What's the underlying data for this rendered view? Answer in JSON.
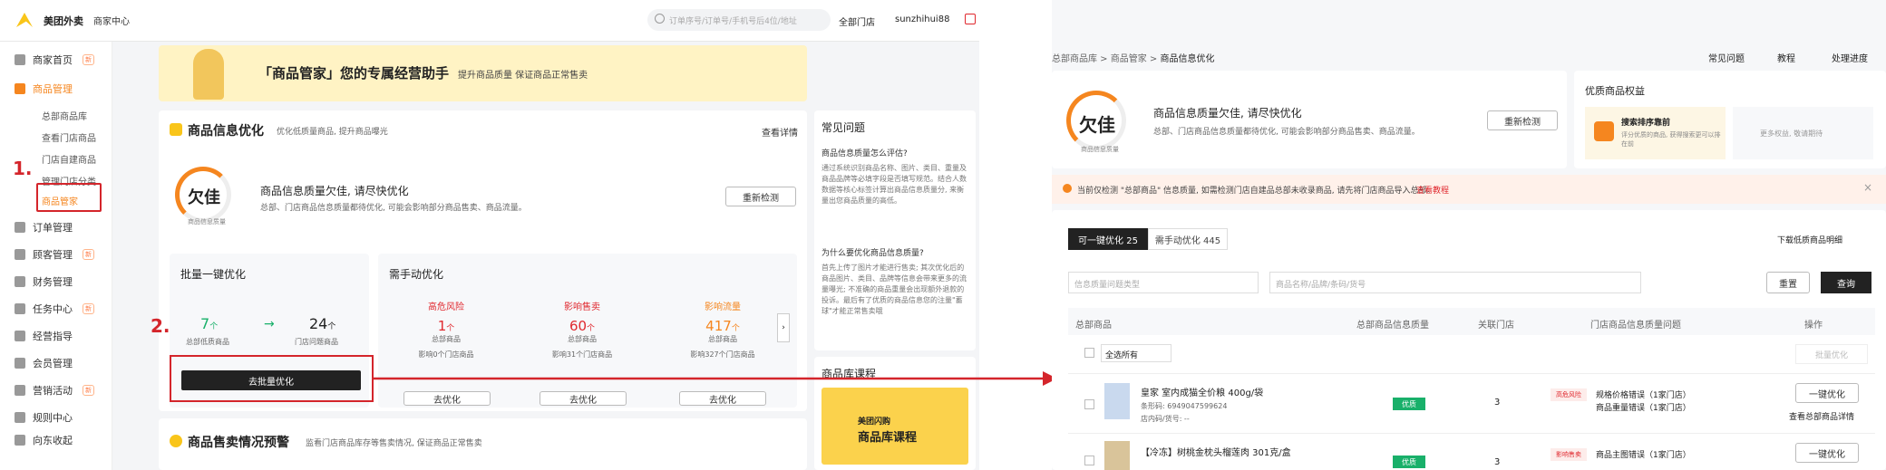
{
  "topbar": {
    "logo": "美团外卖",
    "section": "商家中心",
    "search_placeholder": "订单序号/订单号/手机号后4位/地址",
    "store_select": "全部门店",
    "user": "sunzhihui88"
  },
  "sidebar": {
    "items": [
      {
        "label": "商家首页",
        "badge": "新"
      },
      {
        "label": "商品管理",
        "badge": ""
      },
      {
        "label": "订单管理",
        "badge": ""
      },
      {
        "label": "顾客管理",
        "badge": "新"
      },
      {
        "label": "财务管理",
        "badge": ""
      },
      {
        "label": "任务中心",
        "badge": "新"
      },
      {
        "label": "经营指导",
        "badge": ""
      },
      {
        "label": "会员管理",
        "badge": ""
      },
      {
        "label": "营销活动",
        "badge": "新"
      },
      {
        "label": "规则中心",
        "badge": ""
      },
      {
        "label": "向东收起",
        "badge": ""
      }
    ],
    "sub_items": [
      "总部商品库",
      "查看门店商品",
      "门店自建商品",
      "管理门店分类",
      "商品管家"
    ]
  },
  "steps": {
    "one": "1.",
    "two": "2."
  },
  "banner": {
    "title": "「商品管家」您的专属经营助手",
    "subtitle": "提升商品质量 保证商品正常售卖"
  },
  "optimize": {
    "title": "商品信息优化",
    "subtitle": "优化低质量商品, 提升商品曝光",
    "view_detail": "查看详情",
    "grade": "欠佳",
    "grade_caption": "商品信息质量",
    "status_title": "商品信息质量欠佳, 请尽快优化",
    "status_desc": "总部、门店商品信息质量都待优化, 可能会影响部分商品售卖、商品流量。",
    "refresh": "重新检测"
  },
  "batch": {
    "title": "批量一键优化",
    "left_num": "7",
    "left_unit": "个",
    "left_label": "总部低质商品",
    "right_num": "24",
    "right_unit": "个",
    "right_label": "门店问题商品",
    "button": "去批量优化"
  },
  "manual": {
    "title": "需手动优化",
    "cols": [
      {
        "label": "高危风险",
        "num": "1",
        "unit": "个",
        "sub": "总部商品",
        "note": "影响0个门店商品",
        "btn": "去优化"
      },
      {
        "label": "影响售卖",
        "num": "60",
        "unit": "个",
        "sub": "总部商品",
        "note": "影响31个门店商品",
        "btn": "去优化"
      },
      {
        "label": "影响流量",
        "num": "417",
        "unit": "个",
        "sub": "总部商品",
        "note": "影响327个门店商品",
        "btn": "去优化"
      }
    ]
  },
  "faq": {
    "title": "常见问题",
    "q1": "商品信息质量怎么评估?",
    "a1": "通过系统识别商品名称、图片、类目、重量及商品品牌等必填字段是否填写规范。结合人数数据等核心标签计算出商品信息质量分, 来衡量出您商品质量的高低。",
    "q2": "为什么要优化商品信息质量?",
    "a2": "首先上传了图片才能进行售卖; 其次优化后的商品图片、类目、品牌等信息会带来更多的流量曝光; 不准确的商品重量会出现额外退款的投诉。最后有了优质的商品信息您的注量\"蓄球\"才能正常售卖哦"
  },
  "course": {
    "title": "商品库课程",
    "brand": "美团闪购",
    "name": "商品库课程"
  },
  "sales_warning": {
    "title": "商品售卖情况预警",
    "desc": "监看门店商品库存等售卖情况, 保证商品正常售卖"
  },
  "right": {
    "breadcrumb": [
      "总部商品库",
      "商品管家",
      "商品信息优化"
    ],
    "toplinks": [
      "常见问题",
      "教程",
      "处理进度"
    ],
    "grade": "欠佳",
    "grade_caption": "商品信息质量",
    "status_title": "商品信息质量欠佳, 请尽快优化",
    "status_desc": "总部、门店商品信息质量都待优化, 可能会影响部分商品售卖、商品流量。",
    "refresh": "重新检测",
    "rights_title": "优质商品权益",
    "rights_1_title": "搜索排序靠前",
    "rights_1_desc": "评分优质的商品, 获得搜索更可以排在前",
    "rights_2": "更多权益, 敬请期待",
    "alert": "当前仅检测 \"总部商品\" 信息质量, 如需检测门店自建品总部未收录商品, 请先将门店商品导入总部。",
    "alert_link": "查看教程",
    "tab_active": "可一键优化 25",
    "tab_other": "需手动优化 445",
    "download": "下载低质商品明细",
    "filter_placeholder": "信息质量问题类型",
    "search_placeholder": "商品名称/品牌/条码/货号",
    "reset": "重置",
    "query": "查询",
    "columns": [
      "总部商品",
      "总部商品信息质量",
      "关联门店",
      "门店商品信息质量问题",
      "操作"
    ],
    "select_all": "全选所有",
    "batch_btn": "批量优化",
    "rows": [
      {
        "name": "皇家 室内成猫全价粮 400g/袋",
        "code": "条形码: 6949047599624",
        "store_code": "店内码/货号: --",
        "quality": "优质",
        "stores": "3",
        "risk": "高危风险",
        "issues": [
          "规格价格错误（1家门店）",
          "商品重量错误（1家门店）"
        ],
        "action": "一键优化",
        "link": "查看总部商品详情"
      },
      {
        "name": "【冷冻】树桃金枕头榴莲肉 301克/盒",
        "code": "",
        "store_code": "",
        "quality": "优质",
        "stores": "3",
        "risk": "影响售卖",
        "issues": [
          "商品主图错误（1家门店）"
        ],
        "action": "一键优化",
        "link": ""
      }
    ]
  }
}
